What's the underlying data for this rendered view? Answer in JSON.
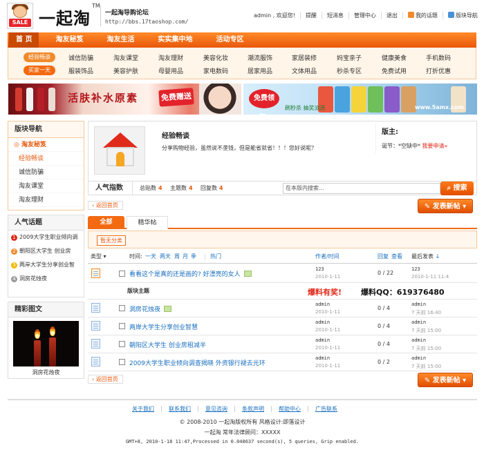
{
  "header": {
    "logo_badge": "SALE",
    "brand": "一起淘",
    "tm": "TM",
    "site_name": "一起淘导购论坛",
    "site_url": "http://bbs.17taoshop.com/",
    "user": "admin",
    "welcome": "欢迎您!",
    "links": [
      "提醒",
      "短消息",
      "管理中心",
      "退出",
      "我的话题",
      "版块导航"
    ]
  },
  "nav": {
    "items": [
      "首 页",
      "淘友秘笈",
      "淘友生活",
      "实实集中地",
      "活动专区"
    ]
  },
  "subnav": {
    "badges": [
      "经验畅谈",
      "买家一天"
    ],
    "row1": [
      "诚信防骗",
      "淘友课堂",
      "淘友理财",
      "美容化妆",
      "潮流服饰",
      "家居装修",
      "妈宝亲子",
      "健康美食",
      "手机数码"
    ],
    "row2": [
      "服装饰品",
      "美容护肤",
      "母婴用品",
      "家电数码",
      "居家用品",
      "文体用品",
      "秒杀专区",
      "免费试用",
      "打折优惠"
    ]
  },
  "banners": {
    "left_text": "活肤补水原素",
    "left_tag": "免费赠送",
    "right_tag": "免费领取!",
    "right_text": "刷秒杀 抽奖派送",
    "right_url": "www.5amx.com"
  },
  "left_nav": {
    "title": "版块导航",
    "main": "淘友秘笈",
    "items": [
      "经验畅谈",
      "诚信防骗",
      "淘友课堂",
      "淘友理财"
    ]
  },
  "hot": {
    "title": "人气话题",
    "items": [
      {
        "n": "1",
        "text": "2009大学生职业倾向调"
      },
      {
        "n": "2",
        "text": "朝阳区大学生   创业房"
      },
      {
        "n": "3",
        "text": "两岸大学生分享创业智"
      },
      {
        "n": "4",
        "text": "洞房花烛夜"
      }
    ],
    "num_colors": [
      "#e02a1a",
      "#f08a2c",
      "#f5b700",
      "#999999"
    ]
  },
  "pic": {
    "title": "精彩图文",
    "caption": "洞房花烛夜"
  },
  "forum": {
    "title": "经验畅谈",
    "desc": "分享购物经验，虽然说不垄钱，但是能省就省！！！您好说呢？",
    "mod_title": "版主:",
    "mod_text": "诞节：*空缺中*",
    "mod_apply": "我要申请»",
    "stat_tab": "人气指数",
    "posts_label": "总贴数",
    "posts": "4",
    "topics_label": "主题数",
    "topics": "4",
    "replies_label": "回复数",
    "replies": "4",
    "search_placeholder": "在本版内搜索...",
    "search_btn": "搜索"
  },
  "actions": {
    "back": "返回首页",
    "post": "发表新帖"
  },
  "tabs": [
    "全部",
    "精华帖"
  ],
  "category": "暂无分类",
  "thead": {
    "type": "类型",
    "time": "时间:",
    "filters": [
      "一天",
      "两天",
      "周",
      "月",
      "季"
    ],
    "hot": "热门",
    "author": "作者/时间",
    "reply": "回复",
    "view": "查看",
    "last": "最后发表"
  },
  "topics": [
    {
      "title": "看看这个是真的还是画的? 好漂亮的女人",
      "author": "123",
      "date": "2010-1-11",
      "replies": "0",
      "views": "22",
      "last": "123",
      "ldate": "2010-1-11 11:4"
    },
    {
      "title": "洞房花烛夜",
      "author": "admin",
      "date": "2010-1-11",
      "replies": "0",
      "views": "4",
      "last": "admin",
      "ldate": "7 天前 16:40"
    },
    {
      "title": "两岸大学生分享创业智慧",
      "author": "admin",
      "date": "2010-1-11",
      "replies": "0",
      "views": "4",
      "last": "admin",
      "ldate": "7 天前 15:00"
    },
    {
      "title": "朝阳区大学生    创业房租减半",
      "author": "admin",
      "date": "2010-1-11",
      "replies": "0",
      "views": "4",
      "last": "admin",
      "ldate": "7 天前 15:00"
    },
    {
      "title": "2009大学生职业倾向调查揭晓 外资银行褪去光环",
      "author": "admin",
      "date": "2010-1-11",
      "replies": "0",
      "views": "2",
      "last": "admin",
      "ldate": "7 天前 15:00"
    }
  ],
  "separator": {
    "label": "版块主题",
    "promo_red": "爆料有奖!",
    "promo_black": "爆料QQ：619376480"
  },
  "footer": {
    "links": [
      "关于我们",
      "联系我们",
      "意见咨询",
      "条款声明",
      "帮助中心",
      "广告联系"
    ],
    "copyright": "© 2008-2010 一起淘版权所有 风格设计:即落设计",
    "legal": "一起淘 常年法律顾问：XXXXX",
    "stats": "GMT+8, 2010-1-18 11:47,Processed in 0.048637 second(s), 5 queries, Grip enabled."
  }
}
